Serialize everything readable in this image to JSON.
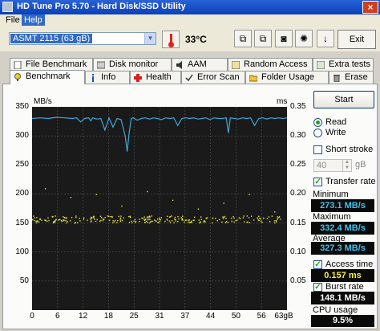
{
  "window": {
    "title": "HD Tune Pro 5.70 - Hard Disk/SSD Utility"
  },
  "menu": [
    "File",
    "Help"
  ],
  "toolbar": {
    "drive": "ASMT    2115 (63 gB)",
    "temperature": "33°C",
    "exit_label": "Exit",
    "icons": [
      "copy-icon",
      "copy-all-icon",
      "camera-icon",
      "options-icon",
      "download-icon"
    ]
  },
  "tabs_row1": [
    "File Benchmark",
    "Disk monitor",
    "AAM",
    "Random Access",
    "Extra tests"
  ],
  "tabs_row2": [
    "Benchmark",
    "Info",
    "Health",
    "Error Scan",
    "Folder Usage",
    "Erase"
  ],
  "active_tab": "Benchmark",
  "controls": {
    "start_label": "Start",
    "read_label": "Read",
    "write_label": "Write",
    "read_selected": true,
    "short_stroke_label": "Short stroke",
    "short_stroke_checked": false,
    "short_stroke_value": "40",
    "short_stroke_unit": "gB",
    "transfer_rate_label": "Transfer rate",
    "transfer_rate_checked": true,
    "minimum_label": "Minimum",
    "minimum_value": "273.1 MB/s",
    "maximum_label": "Maximum",
    "maximum_value": "332.4 MB/s",
    "average_label": "Average",
    "average_value": "327.3 MB/s",
    "access_time_label": "Access time",
    "access_time_checked": true,
    "access_time_value": "0.157 ms",
    "burst_rate_label": "Burst rate",
    "burst_rate_checked": true,
    "burst_rate_value": "148.1 MB/s",
    "cpu_usage_label": "CPU usage",
    "cpu_usage_value": "9.5%"
  },
  "chart_data": {
    "type": "line",
    "left_unit": "MB/s",
    "right_unit": "ms",
    "left_ticks": [
      "350",
      "300",
      "250",
      "200",
      "150",
      "100",
      "50"
    ],
    "right_ticks": [
      "0.35",
      "0.30",
      "0.25",
      "0.20",
      "0.15",
      "0.10",
      "0.05"
    ],
    "x_ticks": [
      "0",
      "6",
      "12",
      "18",
      "25",
      "31",
      "37",
      "44",
      "50",
      "56",
      "63gB"
    ],
    "xlim": [
      0,
      63
    ],
    "ylim_left": [
      0,
      350
    ],
    "ylim_right": [
      0,
      0.35
    ],
    "series": [
      {
        "color": "#3fa8d8",
        "axis": "left",
        "x": [
          0,
          2,
          4,
          6,
          8,
          10,
          11,
          12,
          13,
          14,
          14.5,
          15,
          15.5,
          16,
          17,
          18,
          19,
          20,
          21,
          22,
          23,
          23.5,
          24,
          24.5,
          25,
          26,
          27,
          28,
          29,
          30,
          31,
          32,
          33,
          34,
          35,
          36,
          37,
          38,
          39,
          40,
          41,
          42,
          43,
          44,
          45,
          46,
          47,
          48,
          48.5,
          49,
          50,
          51,
          52,
          53,
          54,
          55,
          56,
          57,
          58,
          59,
          60,
          61,
          62,
          63
        ],
        "y": [
          330,
          331,
          330,
          332,
          331,
          330,
          331,
          324,
          330,
          331,
          326,
          331,
          330,
          329,
          330,
          310,
          331,
          315,
          330,
          328,
          300,
          273,
          305,
          330,
          331,
          327,
          330,
          331,
          329,
          331,
          330,
          328,
          331,
          330,
          331,
          318,
          330,
          331,
          330,
          331,
          329,
          330,
          331,
          328,
          331,
          330,
          330,
          331,
          305,
          331,
          330,
          329,
          331,
          330,
          331,
          318,
          330,
          331,
          329,
          331,
          330,
          331,
          330,
          331
        ]
      }
    ],
    "scatter": {
      "color": "#e8e33a",
      "axis": "right",
      "typical_ms": 0.157,
      "outliers_ms": [
        0.21,
        0.195,
        0.2,
        0.18,
        0.205,
        0.19,
        0.175,
        0.185,
        0.2,
        0.17
      ]
    }
  }
}
